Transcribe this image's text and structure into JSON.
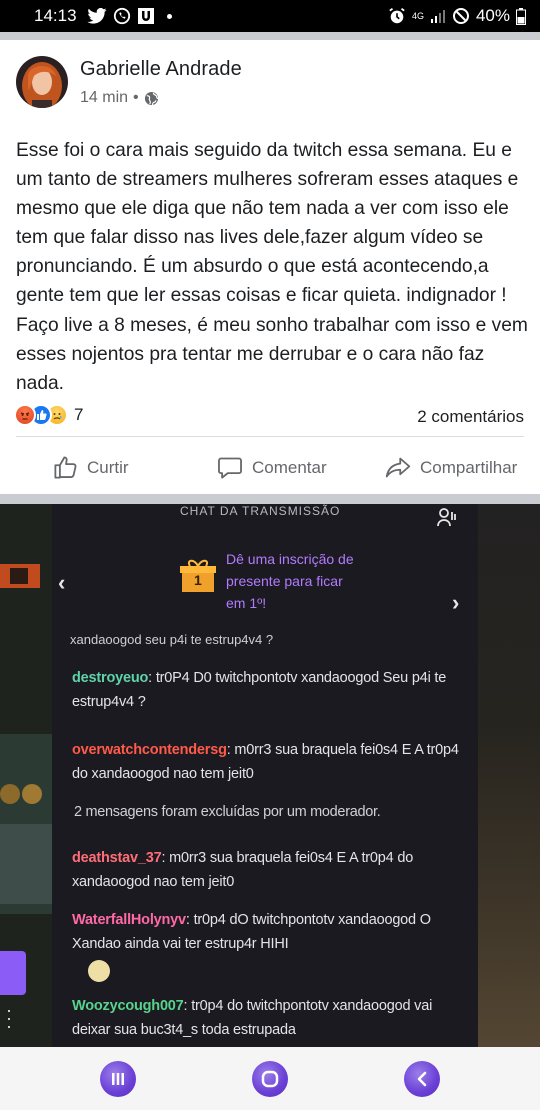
{
  "status_bar": {
    "time": "14:13",
    "network": "4G",
    "battery": "40%"
  },
  "post": {
    "author": "Gabrielle Andrade",
    "time_ago": "14 min",
    "separator": "•",
    "privacy_icon": "globe-icon",
    "text": "Esse foi o cara mais seguido da twitch essa semana. Eu e um tanto de streamers mulheres sofreram esses ataques e mesmo que ele diga que não tem nada a ver com isso ele tem que falar disso nas lives dele,fazer algum vídeo se pronunciando. É um absurdo o que está acontecendo,a gente tem que ler essas coisas e ficar quieta. indignador ! Faço live a 8 meses, é meu sonho trabalhar com isso e vem esses nojentos pra tentar me derrubar e o cara não faz nada.",
    "reactions_count": "7",
    "reaction_icons": [
      "angry-reaction-icon",
      "like-reaction-icon",
      "sad-reaction-icon"
    ],
    "comments_count": "2 comentários",
    "actions": {
      "like": "Curtir",
      "comment": "Comentar",
      "share": "Compartilhar"
    }
  },
  "photo": {
    "header": "CHAT DA TRANSMISSÃO",
    "gift_number": "1",
    "gift_text": "Dê uma inscrição de presente para ficar em 1º!",
    "cut_line": "xandaoogod seu p4i te estrup4v4 ?",
    "messages": [
      {
        "user": "destroyeuo",
        "color": "#5fd3a8",
        "text": "tr0P4 D0 twitchpontotv xandaoogod Seu p4i te estrup4v4 ?"
      },
      {
        "user": "overwatchcontendersg",
        "color": "#ff5a4a",
        "text": "m0rr3 sua braquela fei0s4 E A tr0p4 do xandaoogod nao tem jeit0"
      },
      {
        "user": "deathstav_37",
        "color": "#ff6e78",
        "text": "m0rr3 sua braquela fei0s4 E A tr0p4 do xandaoogod nao tem jeit0"
      },
      {
        "user": "WaterfallHolynyv",
        "color": "#ff6aa6",
        "text": "tr0p4 dO twitchpontotv xandaoogod O Xandao ainda vai ter estrup4r HIHI"
      },
      {
        "user": "Woozycough007",
        "color": "#57d38c",
        "text": "tr0p4 do twitchpontotv xandaoogod vai deixar sua buc3t4_s toda estrupada"
      }
    ],
    "system_message": "2 mensagens foram excluídas por um moderador."
  },
  "nav_bar": {
    "recents_icon": "recent-apps-icon",
    "home_icon": "home-icon",
    "back_icon": "back-icon"
  },
  "colors": {
    "brand_purple": "#6a3fd6",
    "twitch_purple": "#b27bff",
    "text_primary": "#1c1e21",
    "text_secondary": "#65676b"
  }
}
